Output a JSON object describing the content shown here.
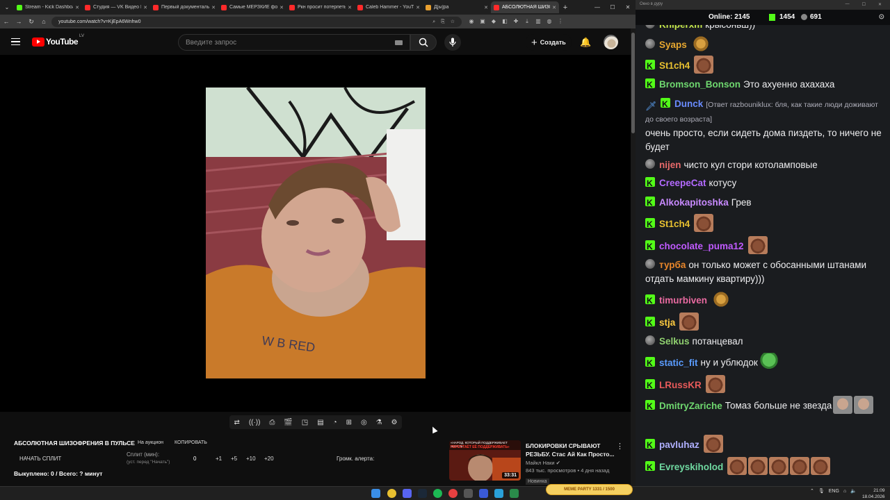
{
  "browser": {
    "tabs": [
      {
        "title": "Stream - Kick Dashboard",
        "favicon_color": "#53fc18"
      },
      {
        "title": "Студия — VK Видео Live",
        "favicon_color": "#ff2a2a"
      },
      {
        "title": "Первый документальный",
        "favicon_color": "#ff2a2a"
      },
      {
        "title": "Самые МЕРЗКИЕ форумы",
        "favicon_color": "#ff2a2a"
      },
      {
        "title": "Ркн просит потерпеть",
        "favicon_color": "#ff2a2a"
      },
      {
        "title": "Caleb Hammer - YouTube",
        "favicon_color": "#ff2a2a"
      },
      {
        "title": "Д[ы]ра",
        "favicon_color": "#e8a030"
      },
      {
        "title": "АБСОЛЮТНАЯ ШИЗОФРЕНИЯ",
        "favicon_color": "#ff2a2a"
      }
    ],
    "url": "youtube.com/watch?v=KjEpA6Wnhw0"
  },
  "youtube": {
    "logo_text": "YouTube",
    "logo_country": "LV",
    "search_placeholder": "Введите запрос",
    "create_label": "Создать"
  },
  "panel": {
    "video_title": "АБСОЛЮТНАЯ ШИЗОФРЕНИЯ В ПУЛЬСЕ",
    "auction_label": "На аукцион",
    "copy_label": "КОПИРОВАТЬ",
    "start_split": "НАЧАТЬ СПЛИТ",
    "split_label": "Сплит (мин):",
    "split_sub": "(уст. перед \"Начать\")",
    "split_value": "0",
    "add_buttons": [
      "+1",
      "+5",
      "+10",
      "+20"
    ],
    "alert_label": "Громк. алерта:",
    "bought": "Выкуплено: 0 / Всего: ? минут"
  },
  "recommended": {
    "thumb_top": "«НАРОД, КОТОРЫЙ ПОДДЕРЖИВАЕТ ВЛАСТЬ",
    "thumb_top2": "ПЕРЕСТАЁТ ЕЁ ПОДДЕРЖИВАТЬ»",
    "duration": "33:31",
    "title": "БЛОКИРОВКИ СРЫВАЮТ РЕЗЬБУ. Стас Ай Как Просто...",
    "channel": "Майкл Наки ✔",
    "meta": "843 тыс. просмотров • 4 дня назад",
    "badge": "Новинка"
  },
  "chat": {
    "window_title": "Окно в дуру",
    "online_label": "Online:",
    "online_count": "2145",
    "viewers": "1454",
    "followers": "691",
    "messages": [
      {
        "user": "Kniperxm",
        "color": "#c6e84a",
        "badge": "t",
        "text": "крысоньш))",
        "emotes": []
      },
      {
        "user": "Syaps",
        "color": "#e8a830",
        "badge": "t",
        "text": "",
        "emotes": [
          "bear"
        ]
      },
      {
        "user": "St1ch4",
        "color": "#e8c030",
        "badge": "k",
        "text": "",
        "emotes": [
          "face"
        ]
      },
      {
        "user": "Bromson_Bonson",
        "color": "#6fd86f",
        "badge": "k",
        "text": "Это ахуенно ахахаха",
        "emotes": []
      },
      {
        "user": "Dunck",
        "color": "#6a8cff",
        "badge": "sk",
        "text": "",
        "reply": "[Ответ razbouniklux: бля, как такие люди доживают до своего возраста]",
        "cont": "очень просто, если сидеть дома пиздеть, то ничего не будет",
        "emotes": []
      },
      {
        "user": "nijen",
        "color": "#e86a6a",
        "badge": "t",
        "text": "чисто кул стори котоламповые",
        "emotes": []
      },
      {
        "user": "CreepeCat",
        "color": "#b36aff",
        "badge": "k",
        "text": "котусу",
        "emotes": []
      },
      {
        "user": "Alkokapitoshka",
        "color": "#c88aff",
        "badge": "k",
        "text": "Грев",
        "emotes": []
      },
      {
        "user": "St1ch4",
        "color": "#e8c030",
        "badge": "k",
        "text": "",
        "emotes": [
          "face"
        ]
      },
      {
        "user": "chocolate_puma12",
        "color": "#c05aff",
        "badge": "k",
        "text": "",
        "emotes": [
          "face"
        ]
      },
      {
        "user": "турба",
        "color": "#e8862a",
        "badge": "t",
        "text": "он только может с обосанными штанами отдать мамкину квартиру)))",
        "emotes": []
      },
      {
        "user": "timurbiven",
        "color": "#e86aa0",
        "badge": "k",
        "text": "",
        "emotes": [
          "bear"
        ]
      },
      {
        "user": "stja",
        "color": "#ffcc40",
        "badge": "k",
        "text": "",
        "emotes": [
          "face"
        ]
      },
      {
        "user": "Selkus",
        "color": "#8fd06f",
        "badge": "t",
        "text": "потанцевал",
        "emotes": []
      },
      {
        "user": "static_fit",
        "color": "#5a9cff",
        "badge": "k",
        "text": "ну и ублюдок",
        "emotes": [
          "frog"
        ]
      },
      {
        "user": "LRussKR",
        "color": "#e85a5a",
        "badge": "k",
        "text": "",
        "emotes": [
          "face"
        ]
      },
      {
        "user": "DmitryZariche",
        "color": "#6fd86f",
        "badge": "k",
        "text": "Томаз больше не звезда",
        "emotes": [
          "man",
          "man"
        ]
      },
      {
        "user": "pavluhaz",
        "color": "#b0b0ff",
        "badge": "k",
        "text": "",
        "emotes": [
          "face"
        ]
      },
      {
        "user": "Evreyskiholod",
        "color": "#6fd8a0",
        "badge": "k",
        "text": "",
        "emotes": [
          "face",
          "face",
          "face",
          "face",
          "face"
        ]
      }
    ]
  },
  "taskbar": {
    "lang": "ENG",
    "time": "21:09",
    "date": "18.04.2026",
    "widget": "MEME PARTY 1331 / 1500"
  }
}
